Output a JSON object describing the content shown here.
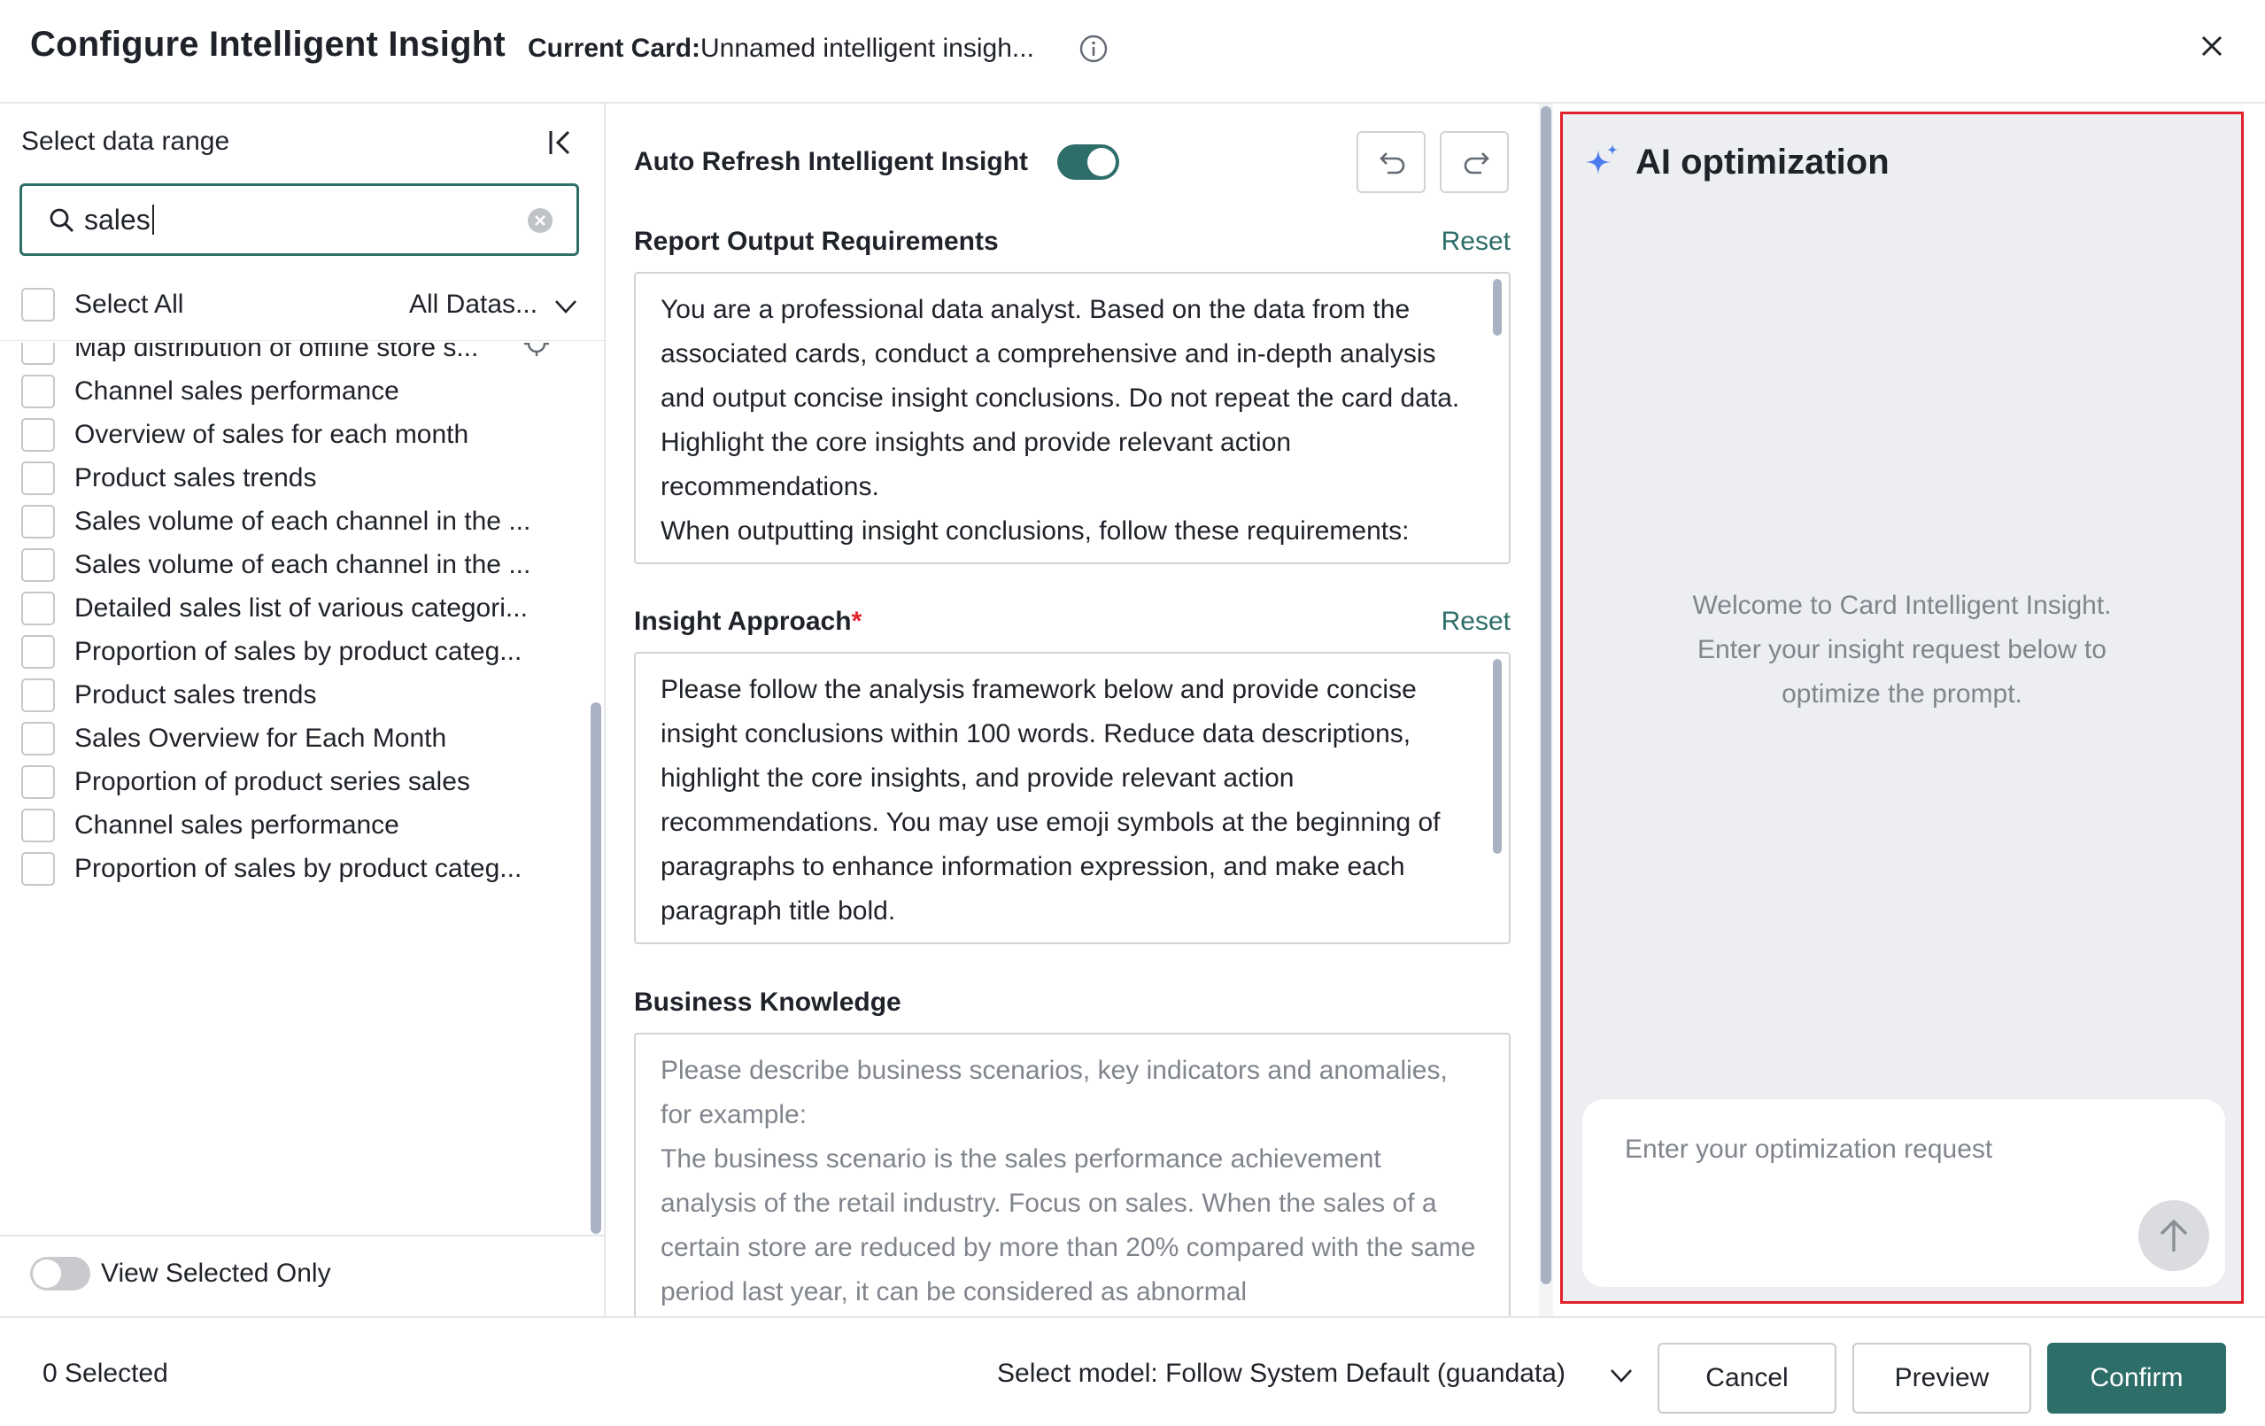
{
  "header": {
    "title": "Configure Intelligent Insight",
    "current_card_label": "Current Card:",
    "current_card_value": "Unnamed intelligent insigh..."
  },
  "left_panel": {
    "range_label": "Select data range",
    "search": {
      "value": "sales"
    },
    "select_all_label": "Select All",
    "dataset_filter": "All Datas...",
    "items": [
      {
        "label": "Map distribution of offline store s...",
        "checked": false
      },
      {
        "label": "Channel sales performance",
        "checked": false
      },
      {
        "label": "Overview of sales for each month",
        "checked": false
      },
      {
        "label": "Product sales trends",
        "checked": false
      },
      {
        "label": "Sales volume of each channel in the ...",
        "checked": false
      },
      {
        "label": "Sales volume of each channel in the ...",
        "checked": false
      },
      {
        "label": "Detailed sales list of various categori...",
        "checked": false
      },
      {
        "label": "Proportion of sales by product categ...",
        "checked": false
      },
      {
        "label": "Product sales trends",
        "checked": false
      },
      {
        "label": "Sales Overview for Each Month",
        "checked": false
      },
      {
        "label": "Proportion of product series sales",
        "checked": false
      },
      {
        "label": "Channel sales performance",
        "checked": false
      },
      {
        "label": "Proportion of sales by product categ...",
        "checked": false
      }
    ],
    "view_selected_label": "View Selected Only",
    "view_selected_on": false
  },
  "middle_panel": {
    "auto_refresh_label": "Auto Refresh Intelligent Insight",
    "auto_refresh_on": true,
    "report_output": {
      "title": "Report Output Requirements",
      "reset_label": "Reset",
      "text": "You are a professional data analyst. Based on the data from the associated cards, conduct a comprehensive and in-depth analysis and output concise insight conclusions. Do not repeat the card data. Highlight the core insights and provide relevant action recommendations.\nWhen outputting insight conclusions, follow these requirements:"
    },
    "insight_approach": {
      "title": "Insight Approach",
      "required_mark": "*",
      "reset_label": "Reset",
      "text": "Please follow the analysis framework below and provide concise insight conclusions within 100 words. Reduce data descriptions, highlight the core insights, and provide relevant action recommendations. You may use emoji symbols at the beginning of paragraphs to enhance information expression, and make each paragraph title bold."
    },
    "business_knowledge": {
      "title": "Business Knowledge",
      "placeholder": "Please describe business scenarios, key indicators and anomalies, for example:\nThe business scenario is the sales performance achievement analysis of the retail industry. Focus on sales. When the sales of a certain store are reduced by more than 20% compared with the same period last year, it can be considered as abnormal"
    }
  },
  "ai_panel": {
    "title": "AI optimization",
    "welcome_lines": [
      "Welcome to Card Intelligent Insight.",
      "Enter your insight request below to",
      "optimize the prompt."
    ],
    "input_placeholder": "Enter your optimization request"
  },
  "footer": {
    "selected_count": "0 Selected",
    "model_label": "Select model: Follow System Default (guandata)",
    "cancel_label": "Cancel",
    "preview_label": "Preview",
    "confirm_label": "Confirm"
  },
  "colors": {
    "primary": "#2e6e69",
    "highlight_border": "#e1202b",
    "ai_panel_bg": "#eceef2",
    "sparkle": "#4a7cf0"
  },
  "icons": [
    "info-icon",
    "close-icon",
    "collapse-icon",
    "search-icon",
    "clear-icon",
    "chevron-down-icon",
    "location-icon",
    "undo-icon",
    "redo-icon",
    "sparkle-icon",
    "arrow-up-icon"
  ]
}
